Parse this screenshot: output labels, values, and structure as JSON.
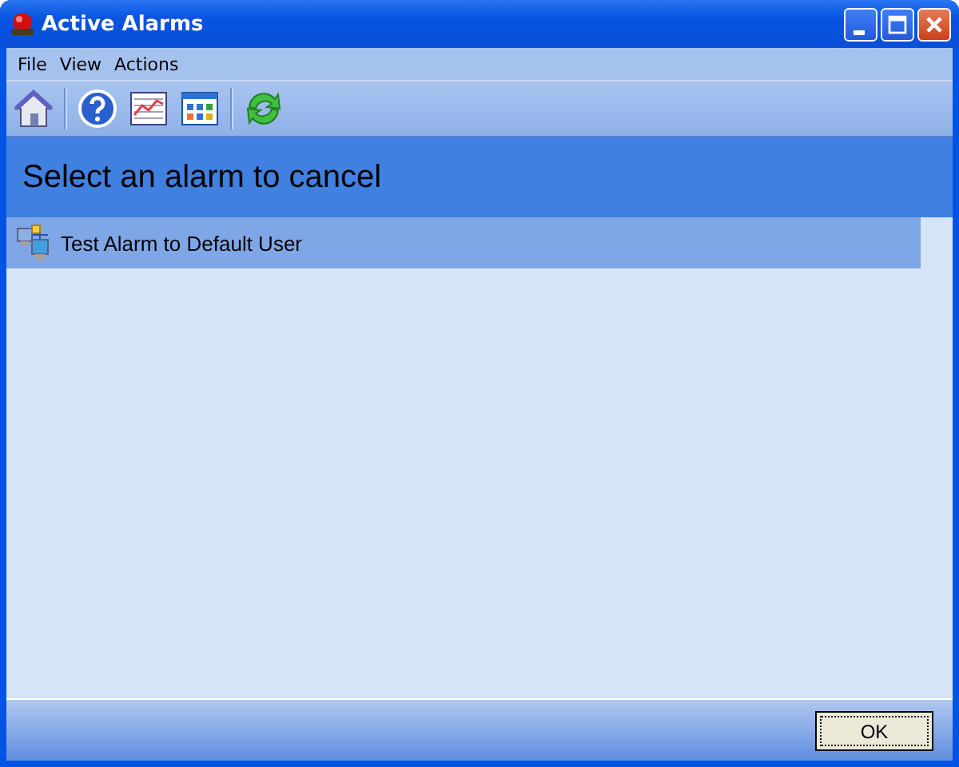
{
  "window": {
    "title": "Active Alarms"
  },
  "menu": [
    "File",
    "View",
    "Actions"
  ],
  "header": "Select an alarm to cancel",
  "alarms": [
    {
      "label": "Test Alarm to Default User",
      "selected": true
    }
  ],
  "buttons": [
    "OK"
  ]
}
